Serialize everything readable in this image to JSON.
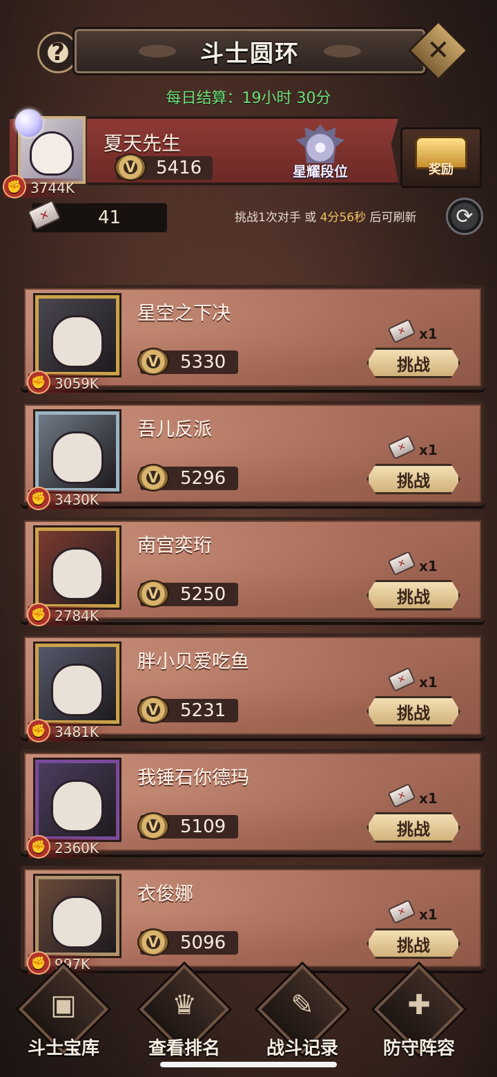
{
  "header": {
    "title": "斗士圆环",
    "help_label": "?",
    "close_label": "✕"
  },
  "settlement": "每日结算：19小时 30分",
  "player": {
    "name": "夏天先生",
    "score": "5416",
    "power": "3744K",
    "rank_label": "星耀段位",
    "reward_label": "奖励",
    "tickets": "41"
  },
  "refresh": {
    "prefix": "挑战1次对手 或 ",
    "time": "4分56秒",
    "suffix": " 后可刷新"
  },
  "opponents": [
    {
      "name": "星空之下决",
      "score": "5330",
      "power": "3059K",
      "cost": "x1",
      "button": "挑战",
      "frame": "#caa24a",
      "bg": "#4a4650"
    },
    {
      "name": "吾儿反派",
      "score": "5296",
      "power": "3430K",
      "cost": "x1",
      "button": "挑战",
      "frame": "#9bb3c2",
      "bg": "#6f7a86"
    },
    {
      "name": "南宫奕珩",
      "score": "5250",
      "power": "2784K",
      "cost": "x1",
      "button": "挑战",
      "frame": "#caa24a",
      "bg": "#7b3b30"
    },
    {
      "name": "胖小贝爱吃鱼",
      "score": "5231",
      "power": "3481K",
      "cost": "x1",
      "button": "挑战",
      "frame": "#caa24a",
      "bg": "#55586a"
    },
    {
      "name": "我锤石你德玛",
      "score": "5109",
      "power": "2360K",
      "cost": "x1",
      "button": "挑战",
      "frame": "#7a4a9a",
      "bg": "#4b3d5e"
    },
    {
      "name": "衣俊娜",
      "score": "5096",
      "power": "997K",
      "cost": "x1",
      "button": "挑战",
      "frame": "#b0926c",
      "bg": "#6a4a3a"
    }
  ],
  "bottom_nav": [
    {
      "label": "斗士宝库",
      "icon": "treasure-chest-icon",
      "glyph": "▣"
    },
    {
      "label": "查看排名",
      "icon": "trophy-icon",
      "glyph": "♛"
    },
    {
      "label": "战斗记录",
      "icon": "scroll-icon",
      "glyph": "✎"
    },
    {
      "label": "防守阵容",
      "icon": "shield-icon",
      "glyph": "✚"
    }
  ],
  "colors": {
    "settle_green": "#6fe07a",
    "banner_red": "#8e3a36",
    "card_bg": "#a96c5a",
    "button_gold": "#d1b27c"
  }
}
